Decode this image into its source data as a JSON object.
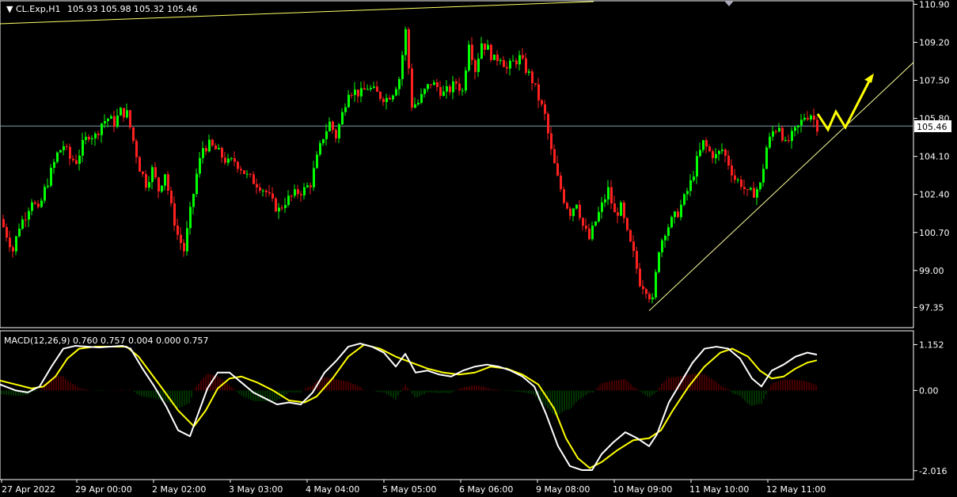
{
  "window": {
    "symbol": "CL.Exp,H1",
    "ohlc": "105.93 105.98 105.32 105.46"
  },
  "macd_label": "MACD(12,26,9) 0.760 0.757 0.004 0.000 0.757",
  "colors": {
    "background": "#000000",
    "bull": "#00ff00",
    "bear": "#ff2020",
    "grid": "#ffffff",
    "price_line": "#7f9fb0",
    "trendline": "#ffff99",
    "arrow": "#ffff00",
    "macd_line": "#ffffff",
    "signal_line": "#ffff00",
    "hist_pos": "#8b0000",
    "hist_neg": "#006400"
  },
  "chart_data": [
    {
      "type": "candlestick",
      "title": "CL.Exp,H1",
      "price_axis_ticks": [
        "110.90",
        "109.20",
        "107.50",
        "105.80",
        "104.10",
        "102.40",
        "100.70",
        "99.00",
        "97.35"
      ],
      "current_price": "105.46",
      "ylim": [
        96.8,
        110.95
      ],
      "x_labels": [
        "27 Apr 2022",
        "29 Apr 00:00",
        "2 May 02:00",
        "3 May 03:00",
        "4 May 04:00",
        "5 May 05:00",
        "6 May 06:00",
        "9 May 08:00",
        "10 May 09:00",
        "11 May 10:00",
        "12 May 11:00"
      ],
      "close_path": [
        [
          0,
          101.3
        ],
        [
          8,
          100.6
        ],
        [
          16,
          99.9
        ],
        [
          24,
          101.0
        ],
        [
          32,
          101.5
        ],
        [
          40,
          102.2
        ],
        [
          48,
          101.6
        ],
        [
          56,
          102.6
        ],
        [
          64,
          103.4
        ],
        [
          72,
          104.2
        ],
        [
          80,
          104.6
        ],
        [
          88,
          104.0
        ],
        [
          96,
          103.9
        ],
        [
          104,
          104.6
        ],
        [
          112,
          105.1
        ],
        [
          120,
          105.0
        ],
        [
          128,
          105.6
        ],
        [
          136,
          105.8
        ],
        [
          144,
          105.6
        ],
        [
          152,
          106.1
        ],
        [
          160,
          106.0
        ],
        [
          168,
          104.8
        ],
        [
          176,
          103.6
        ],
        [
          184,
          102.9
        ],
        [
          192,
          103.5
        ],
        [
          200,
          102.6
        ],
        [
          208,
          103.4
        ],
        [
          216,
          101.8
        ],
        [
          224,
          100.6
        ],
        [
          232,
          99.9
        ],
        [
          240,
          101.6
        ],
        [
          248,
          103.3
        ],
        [
          256,
          104.5
        ],
        [
          264,
          104.6
        ],
        [
          272,
          104.4
        ],
        [
          280,
          104.1
        ],
        [
          288,
          103.8
        ],
        [
          296,
          103.9
        ],
        [
          304,
          103.6
        ],
        [
          312,
          103.2
        ],
        [
          320,
          103.0
        ],
        [
          328,
          102.8
        ],
        [
          336,
          102.5
        ],
        [
          344,
          102.0
        ],
        [
          352,
          101.7
        ],
        [
          360,
          102.1
        ],
        [
          368,
          102.3
        ],
        [
          376,
          102.5
        ],
        [
          384,
          102.6
        ],
        [
          392,
          102.9
        ],
        [
          400,
          104.0
        ],
        [
          408,
          105.0
        ],
        [
          416,
          105.6
        ],
        [
          424,
          105.0
        ],
        [
          432,
          106.0
        ],
        [
          440,
          107.1
        ],
        [
          448,
          107.0
        ],
        [
          456,
          106.9
        ],
        [
          464,
          107.2
        ],
        [
          472,
          107.0
        ],
        [
          480,
          106.8
        ],
        [
          488,
          106.7
        ],
        [
          496,
          107.0
        ],
        [
          504,
          107.6
        ],
        [
          512,
          109.7
        ],
        [
          520,
          106.4
        ],
        [
          528,
          106.5
        ],
        [
          536,
          107.0
        ],
        [
          544,
          107.4
        ],
        [
          552,
          107.2
        ],
        [
          560,
          106.9
        ],
        [
          568,
          107.1
        ],
        [
          576,
          107.4
        ],
        [
          584,
          107.0
        ],
        [
          592,
          109.3
        ],
        [
          600,
          108.0
        ],
        [
          608,
          109.2
        ],
        [
          616,
          108.9
        ],
        [
          624,
          108.4
        ],
        [
          632,
          108.6
        ],
        [
          640,
          108.0
        ],
        [
          648,
          108.3
        ],
        [
          656,
          108.5
        ],
        [
          664,
          108.0
        ],
        [
          672,
          107.5
        ],
        [
          680,
          106.7
        ],
        [
          688,
          105.9
        ],
        [
          696,
          104.3
        ],
        [
          704,
          103.1
        ],
        [
          712,
          102.2
        ],
        [
          720,
          101.6
        ],
        [
          728,
          102.1
        ],
        [
          736,
          101.0
        ],
        [
          744,
          100.4
        ],
        [
          752,
          101.2
        ],
        [
          760,
          101.9
        ],
        [
          768,
          102.6
        ],
        [
          776,
          101.5
        ],
        [
          784,
          101.8
        ],
        [
          792,
          100.6
        ],
        [
          800,
          99.7
        ],
        [
          808,
          98.5
        ],
        [
          816,
          98.2
        ],
        [
          824,
          97.6
        ],
        [
          832,
          100.0
        ],
        [
          840,
          100.8
        ],
        [
          848,
          101.2
        ],
        [
          856,
          101.6
        ],
        [
          864,
          102.2
        ],
        [
          872,
          102.9
        ],
        [
          880,
          103.9
        ],
        [
          888,
          104.7
        ],
        [
          896,
          104.3
        ],
        [
          904,
          104.1
        ],
        [
          912,
          104.4
        ],
        [
          920,
          103.8
        ],
        [
          928,
          103.1
        ],
        [
          936,
          102.9
        ],
        [
          944,
          102.4
        ],
        [
          952,
          102.5
        ],
        [
          960,
          102.8
        ],
        [
          968,
          104.5
        ],
        [
          976,
          105.2
        ],
        [
          984,
          105.5
        ],
        [
          992,
          104.6
        ],
        [
          1000,
          105.0
        ],
        [
          1008,
          105.4
        ],
        [
          1016,
          105.9
        ],
        [
          1024,
          106.0
        ],
        [
          1032,
          105.46
        ]
      ]
    },
    {
      "type": "macd",
      "label": "MACD(12,26,9) 0.760 0.757 0.004 0.000 0.757",
      "axis_ticks": [
        "1.152",
        "0.00",
        "-2.016"
      ],
      "ylim": [
        -2.1,
        1.3
      ],
      "macd": [
        [
          0,
          0.15
        ],
        [
          20,
          0.0
        ],
        [
          35,
          -0.05
        ],
        [
          50,
          0.1
        ],
        [
          65,
          0.6
        ],
        [
          80,
          1.05
        ],
        [
          95,
          1.12
        ],
        [
          110,
          1.1
        ],
        [
          125,
          1.08
        ],
        [
          140,
          1.1
        ],
        [
          155,
          1.12
        ],
        [
          165,
          1.05
        ],
        [
          180,
          0.55
        ],
        [
          195,
          0.1
        ],
        [
          210,
          -0.4
        ],
        [
          225,
          -1.0
        ],
        [
          240,
          -1.15
        ],
        [
          250,
          -0.6
        ],
        [
          262,
          0.05
        ],
        [
          275,
          0.45
        ],
        [
          290,
          0.45
        ],
        [
          305,
          0.2
        ],
        [
          320,
          -0.05
        ],
        [
          335,
          -0.2
        ],
        [
          350,
          -0.35
        ],
        [
          365,
          -0.3
        ],
        [
          380,
          -0.35
        ],
        [
          395,
          -0.05
        ],
        [
          410,
          0.45
        ],
        [
          425,
          0.75
        ],
        [
          440,
          1.1
        ],
        [
          455,
          1.18
        ],
        [
          470,
          1.1
        ],
        [
          485,
          0.95
        ],
        [
          500,
          0.6
        ],
        [
          512,
          0.92
        ],
        [
          525,
          0.45
        ],
        [
          540,
          0.5
        ],
        [
          555,
          0.4
        ],
        [
          570,
          0.35
        ],
        [
          585,
          0.5
        ],
        [
          600,
          0.6
        ],
        [
          615,
          0.65
        ],
        [
          630,
          0.6
        ],
        [
          645,
          0.5
        ],
        [
          660,
          0.35
        ],
        [
          675,
          0.1
        ],
        [
          690,
          -0.6
        ],
        [
          705,
          -1.4
        ],
        [
          720,
          -1.9
        ],
        [
          735,
          -2.0
        ],
        [
          748,
          -2.0
        ],
        [
          760,
          -1.6
        ],
        [
          775,
          -1.3
        ],
        [
          790,
          -1.05
        ],
        [
          805,
          -1.2
        ],
        [
          820,
          -1.4
        ],
        [
          830,
          -1.1
        ],
        [
          845,
          -0.3
        ],
        [
          860,
          0.2
        ],
        [
          875,
          0.7
        ],
        [
          890,
          1.05
        ],
        [
          905,
          1.1
        ],
        [
          920,
          1.05
        ],
        [
          935,
          0.8
        ],
        [
          950,
          0.3
        ],
        [
          962,
          0.1
        ],
        [
          975,
          0.5
        ],
        [
          990,
          0.65
        ],
        [
          1005,
          0.85
        ],
        [
          1020,
          0.95
        ],
        [
          1032,
          0.9
        ]
      ],
      "signal": [
        [
          0,
          0.25
        ],
        [
          20,
          0.15
        ],
        [
          40,
          0.05
        ],
        [
          55,
          0.1
        ],
        [
          70,
          0.35
        ],
        [
          85,
          0.8
        ],
        [
          100,
          1.05
        ],
        [
          120,
          1.1
        ],
        [
          145,
          1.1
        ],
        [
          160,
          1.1
        ],
        [
          175,
          0.85
        ],
        [
          190,
          0.45
        ],
        [
          205,
          0.05
        ],
        [
          225,
          -0.5
        ],
        [
          245,
          -0.9
        ],
        [
          260,
          -0.5
        ],
        [
          275,
          0.05
        ],
        [
          290,
          0.3
        ],
        [
          305,
          0.35
        ],
        [
          325,
          0.2
        ],
        [
          345,
          0.0
        ],
        [
          365,
          -0.25
        ],
        [
          385,
          -0.3
        ],
        [
          400,
          -0.15
        ],
        [
          420,
          0.3
        ],
        [
          440,
          0.85
        ],
        [
          460,
          1.15
        ],
        [
          480,
          1.05
        ],
        [
          500,
          0.85
        ],
        [
          520,
          0.7
        ],
        [
          540,
          0.55
        ],
        [
          560,
          0.45
        ],
        [
          580,
          0.4
        ],
        [
          600,
          0.45
        ],
        [
          620,
          0.6
        ],
        [
          640,
          0.55
        ],
        [
          660,
          0.4
        ],
        [
          680,
          0.15
        ],
        [
          700,
          -0.45
        ],
        [
          715,
          -1.2
        ],
        [
          730,
          -1.7
        ],
        [
          745,
          -1.95
        ],
        [
          760,
          -1.8
        ],
        [
          780,
          -1.5
        ],
        [
          800,
          -1.25
        ],
        [
          820,
          -1.2
        ],
        [
          835,
          -1.0
        ],
        [
          850,
          -0.5
        ],
        [
          870,
          0.1
        ],
        [
          890,
          0.6
        ],
        [
          910,
          0.95
        ],
        [
          925,
          1.05
        ],
        [
          945,
          0.85
        ],
        [
          960,
          0.5
        ],
        [
          975,
          0.3
        ],
        [
          990,
          0.35
        ],
        [
          1005,
          0.55
        ],
        [
          1020,
          0.7
        ],
        [
          1032,
          0.757
        ]
      ]
    }
  ]
}
